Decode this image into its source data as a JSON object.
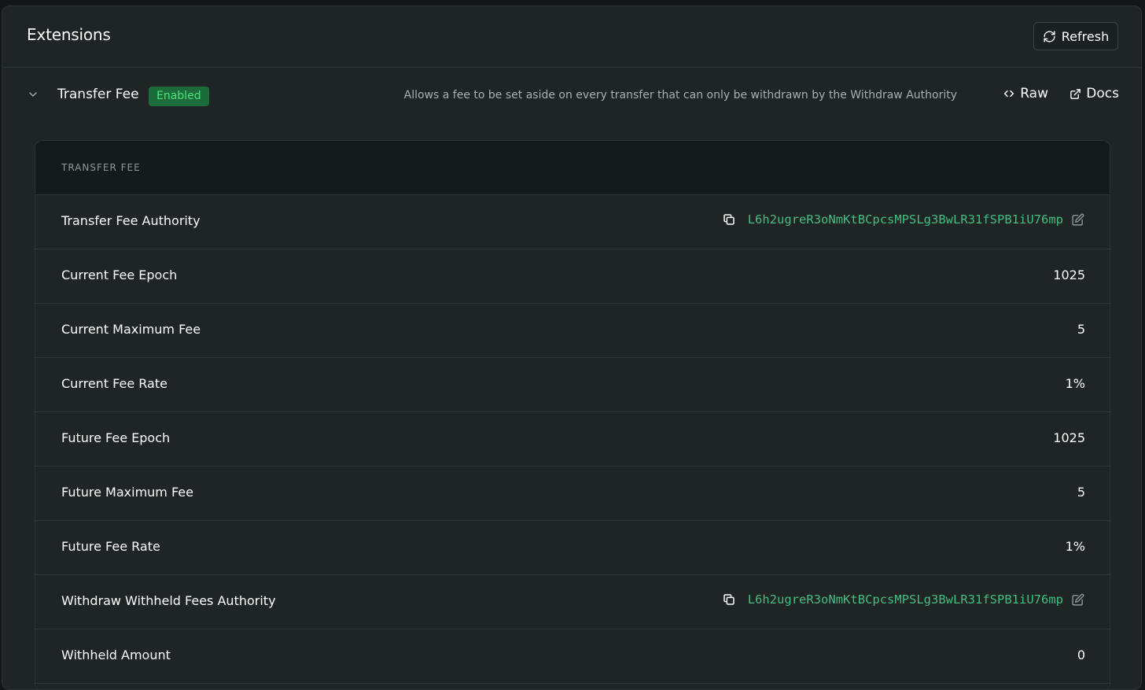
{
  "header": {
    "title": "Extensions",
    "refresh_label": "Refresh",
    "refresh_icon": "refresh-icon"
  },
  "extension": {
    "name": "Transfer Fee",
    "status": "Enabled",
    "description": "Allows a fee to be set aside on every transfer that can only be withdrawn by the Withdraw Authority",
    "raw_label": "Raw",
    "docs_label": "Docs",
    "expanded_icon": "chevron-down-icon"
  },
  "card": {
    "title": "TRANSFER FEE",
    "rows": [
      {
        "label": "Transfer Fee Authority",
        "type": "address",
        "value": "L6h2ugreR3oNmKtBCpcsMPSLg3BwLR31fSPB1iU76mp"
      },
      {
        "label": "Current Fee Epoch",
        "type": "text",
        "value": "1025"
      },
      {
        "label": "Current Maximum Fee",
        "type": "text",
        "value": "5"
      },
      {
        "label": "Current Fee Rate",
        "type": "text",
        "value": "1%"
      },
      {
        "label": "Future Fee Epoch",
        "type": "text",
        "value": "1025"
      },
      {
        "label": "Future Maximum Fee",
        "type": "text",
        "value": "5"
      },
      {
        "label": "Future Fee Rate",
        "type": "text",
        "value": "1%"
      },
      {
        "label": "Withdraw Withheld Fees Authority",
        "type": "address",
        "value": "L6h2ugreR3oNmKtBCpcsMPSLg3BwLR31fSPB1iU76mp"
      },
      {
        "label": "Withheld Amount",
        "type": "text",
        "value": "0"
      }
    ]
  },
  "colors": {
    "background": "#1f2424",
    "badge_bg": "#1d6b3b",
    "badge_text": "#4ae07a",
    "address": "#3fbf82"
  }
}
